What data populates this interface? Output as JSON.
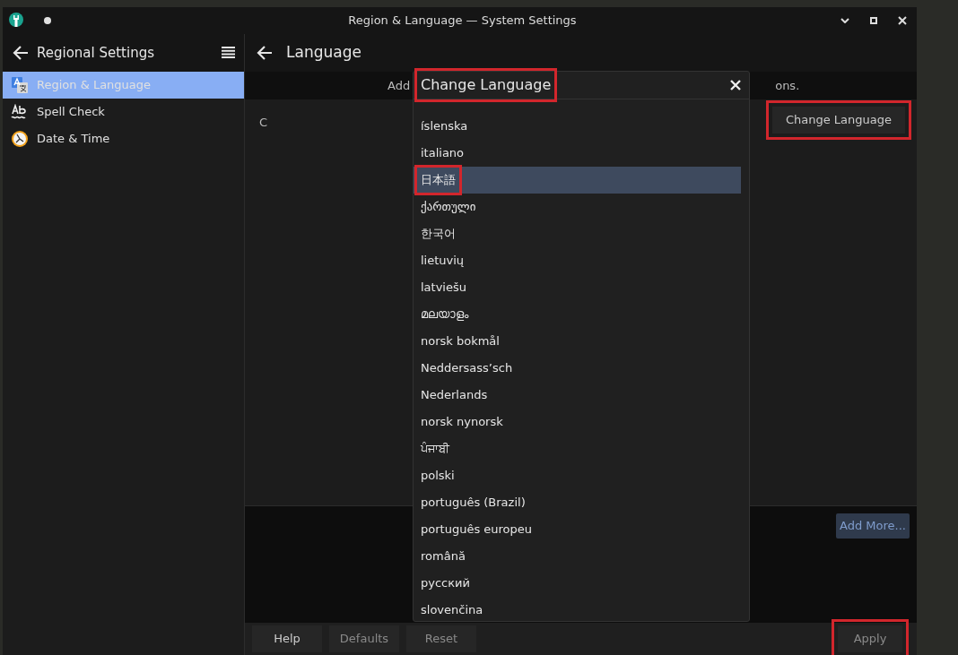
{
  "window": {
    "title": "Region & Language — System Settings"
  },
  "sidebar": {
    "title": "Regional Settings",
    "items": [
      {
        "label": "Region & Language",
        "selected": true
      },
      {
        "label": "Spell Check",
        "selected": false
      },
      {
        "label": "Date & Time",
        "selected": false
      }
    ]
  },
  "page": {
    "title": "Language",
    "hint_left": "Add",
    "hint_right": "ons.",
    "language_label": "C",
    "change_button": {
      "label": "Change Language",
      "highlighted": true
    },
    "add_more_button": "Add More..."
  },
  "dialog": {
    "title": "Change Language",
    "title_highlighted": true,
    "items": [
      {
        "label": "íslenska",
        "selected": false,
        "highlighted": false
      },
      {
        "label": "italiano",
        "selected": false,
        "highlighted": false
      },
      {
        "label": "日本語",
        "selected": true,
        "highlighted": true
      },
      {
        "label": "ქართული",
        "selected": false,
        "highlighted": false
      },
      {
        "label": "한국어",
        "selected": false,
        "highlighted": false
      },
      {
        "label": "lietuvių",
        "selected": false,
        "highlighted": false
      },
      {
        "label": "latviešu",
        "selected": false,
        "highlighted": false
      },
      {
        "label": "മലയാളം",
        "selected": false,
        "highlighted": false
      },
      {
        "label": "norsk bokmål",
        "selected": false,
        "highlighted": false
      },
      {
        "label": "Neddersass’sch",
        "selected": false,
        "highlighted": false
      },
      {
        "label": "Nederlands",
        "selected": false,
        "highlighted": false
      },
      {
        "label": "norsk nynorsk",
        "selected": false,
        "highlighted": false
      },
      {
        "label": "ਪੰਜਾਬੀ",
        "selected": false,
        "highlighted": false
      },
      {
        "label": "polski",
        "selected": false,
        "highlighted": false
      },
      {
        "label": "português (Brazil)",
        "selected": false,
        "highlighted": false
      },
      {
        "label": "português europeu",
        "selected": false,
        "highlighted": false
      },
      {
        "label": "română",
        "selected": false,
        "highlighted": false
      },
      {
        "label": "русский",
        "selected": false,
        "highlighted": false
      },
      {
        "label": "slovenčina",
        "selected": false,
        "highlighted": false
      }
    ]
  },
  "footer": {
    "buttons": [
      {
        "label": "Help",
        "disabled": false,
        "highlighted": false
      },
      {
        "label": "Defaults",
        "disabled": true,
        "highlighted": false
      },
      {
        "label": "Reset",
        "disabled": true,
        "highlighted": false
      }
    ],
    "apply": {
      "label": "Apply",
      "disabled": true,
      "highlighted": true
    }
  }
}
